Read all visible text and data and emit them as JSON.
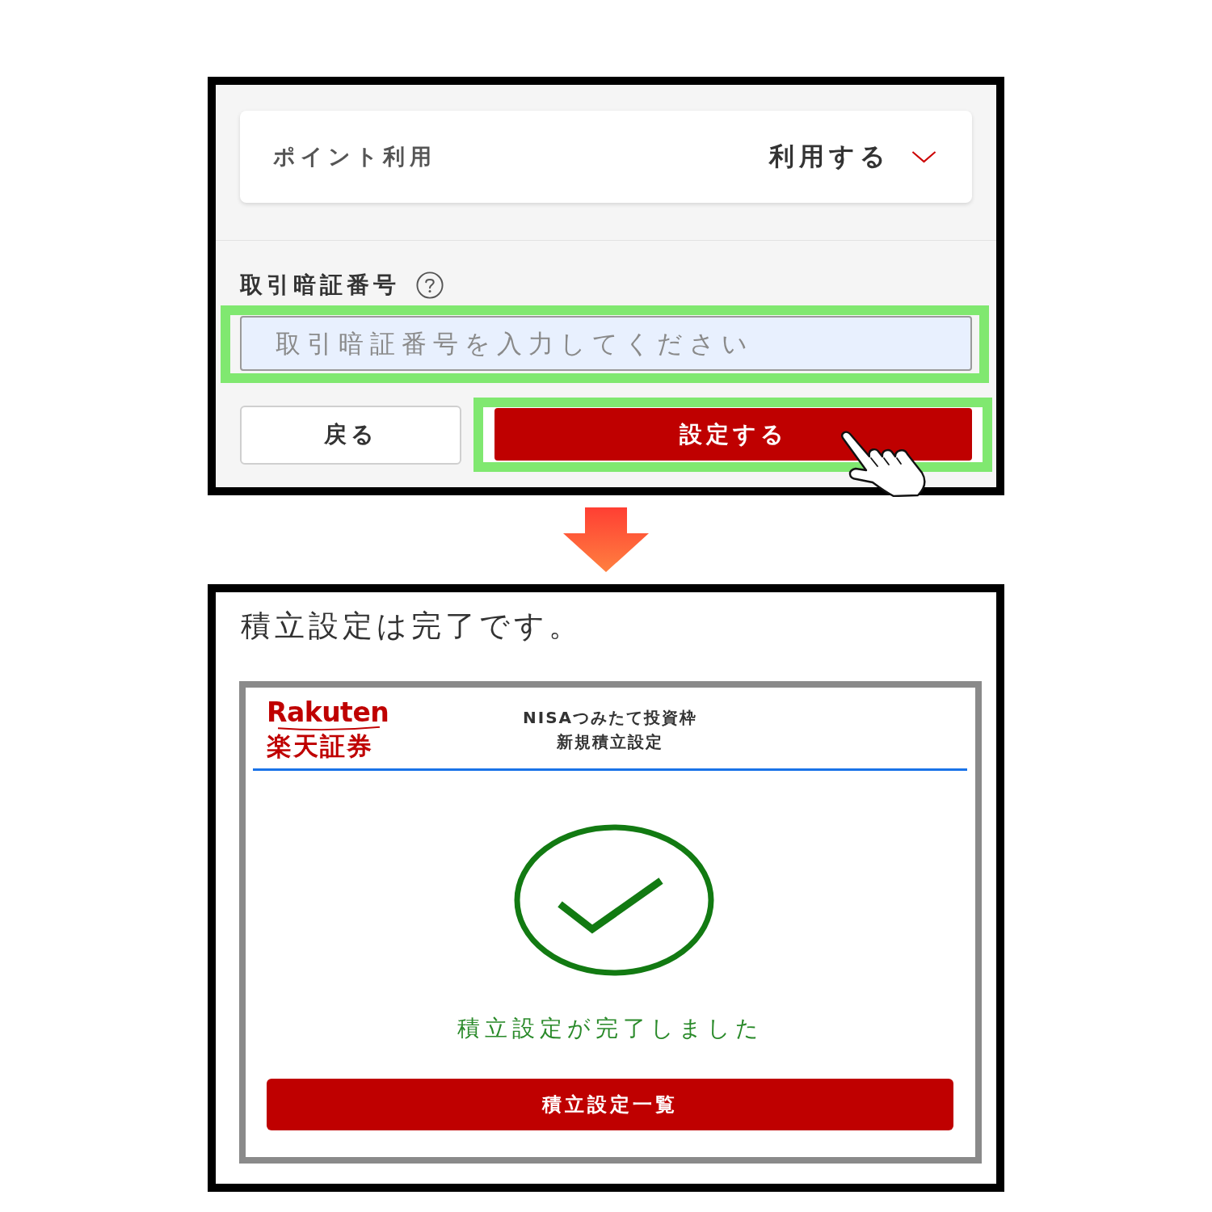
{
  "settings_panel": {
    "point_usage": {
      "label": "ポイント利用",
      "value": "利用する"
    },
    "pin": {
      "label": "取引暗証番号",
      "placeholder": "取引暗証番号を入力してください",
      "highlighted": true
    },
    "buttons": [
      {
        "label": "戻る",
        "kind": "secondary",
        "highlighted": false
      },
      {
        "label": "設定する",
        "kind": "primary",
        "highlighted": true
      }
    ]
  },
  "result_panel": {
    "message": "積立設定は完了です。",
    "screen": {
      "logo": {
        "wordmark": "Rakuten",
        "subtitle": "楽天証券"
      },
      "title_lines": [
        "NISAつみたて投資枠",
        "新規積立設定"
      ],
      "status": "積立設定が完了しました",
      "button": "積立設定一覧"
    }
  }
}
